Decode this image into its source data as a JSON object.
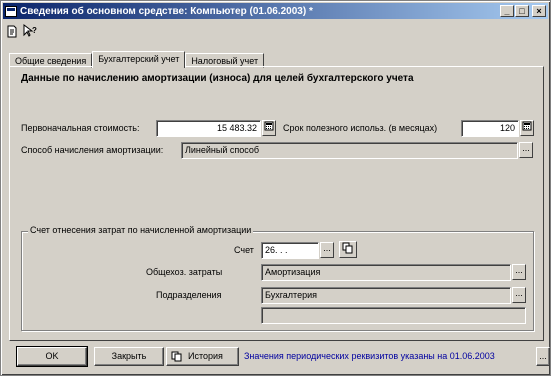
{
  "window": {
    "title": "Сведения об основном средстве: Компьютер (01.06.2003) *",
    "controls": {
      "minimize": "_",
      "maximize": "□",
      "close": "×"
    }
  },
  "toolbar": {
    "icons": [
      "document-icon",
      "help-pointer-icon"
    ]
  },
  "tabs": [
    {
      "label": "Общие сведения",
      "active": false
    },
    {
      "label": "Бухгалтерский учет",
      "active": true
    },
    {
      "label": "Налоговый учет",
      "active": false
    }
  ],
  "section": {
    "title": "Данные по начислению амортизации (износа) для целей бухгалтерского учета"
  },
  "form": {
    "initial_cost_label": "Первоначальная стоимость:",
    "initial_cost_value": "15 483.32",
    "useful_life_label": "Срок полезного использ. (в месяцах)",
    "useful_life_value": "120",
    "method_label": "Способ начисления амортизации:",
    "method_value": "Линейный способ"
  },
  "group": {
    "title": "Счет отнесения затрат по начисленной амортизации",
    "account_label": "Счет",
    "account_value": "26. . .",
    "expenses_label": "Общехоз. затраты",
    "expenses_value": "Амортизация",
    "division_label": "Подразделения",
    "division_value": "Бухгалтерия",
    "extra_value": ""
  },
  "footer": {
    "ok_label": "OK",
    "close_label": "Закрыть",
    "history_label": "История",
    "status_text": "Значения периодических реквизитов указаны на 01.06.2003",
    "more_label": "..."
  },
  "colors": {
    "face": "#d4d0c8",
    "title_start": "#0a246a",
    "title_end": "#a6caf0",
    "status_text": "#0000a0"
  }
}
